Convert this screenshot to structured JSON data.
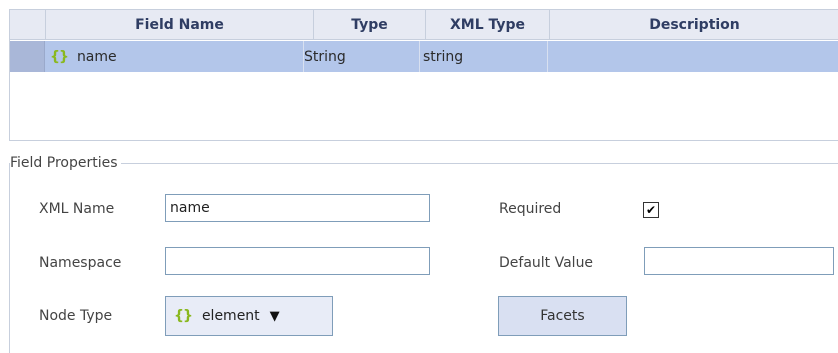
{
  "grid": {
    "columns": [
      "Field Name",
      "Type",
      "XML Type",
      "Description"
    ],
    "rows": [
      {
        "field_name": "name",
        "type": "String",
        "xml_type": "string",
        "description": "",
        "icon": "element-braces-icon"
      }
    ]
  },
  "properties": {
    "legend": "Field Properties",
    "xml_name_label": "XML Name",
    "xml_name_value": "name",
    "namespace_label": "Namespace",
    "namespace_value": "",
    "node_type_label": "Node Type",
    "node_type_value": "element",
    "required_label": "Required",
    "required_checked": true,
    "required_mark": "✔",
    "default_value_label": "Default Value",
    "default_value_value": "",
    "facets_label": "Facets"
  },
  "glyphs": {
    "braces": "{}",
    "dropdown_arrow": "▼"
  },
  "colors": {
    "selected_row": "#b3c6ea",
    "header_bg": "#e7eaf3",
    "border": "#c7cfdd",
    "icon_green": "#8ab820"
  }
}
